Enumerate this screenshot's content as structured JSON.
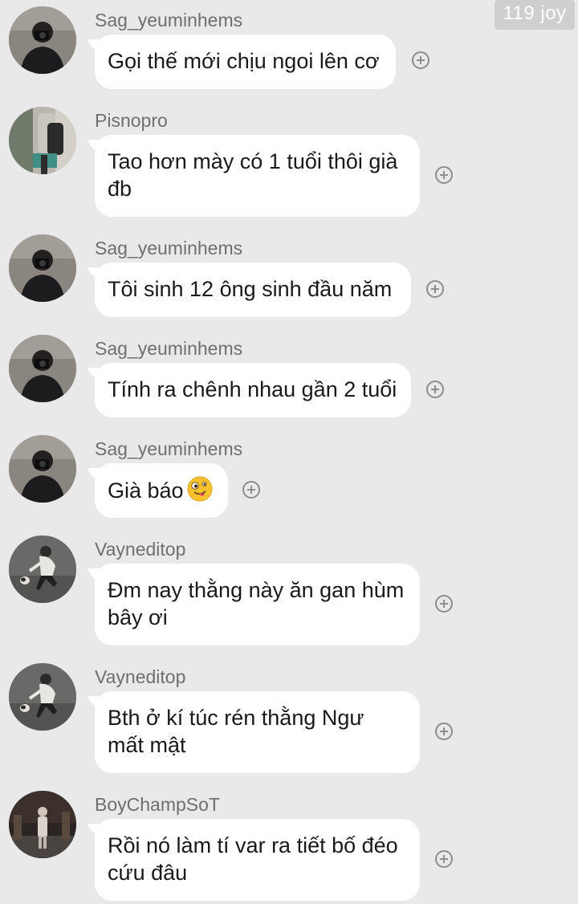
{
  "watermark": "119 joy",
  "messages": [
    {
      "sender": "Sag_yeuminhems",
      "line1": "Gọi thế mới chịu ngoi lên cơ",
      "line2": ""
    },
    {
      "sender": "Pisnopro",
      "line1": "Tao hơn mày có 1 tuổi thôi già",
      "line2": "đb"
    },
    {
      "sender": "Sag_yeuminhems",
      "line1": "Tôi sinh 12 ông sinh đầu năm",
      "line2": ""
    },
    {
      "sender": "Sag_yeuminhems",
      "line1": "Tính ra chênh nhau gần 2 tuổi",
      "line2": ""
    },
    {
      "sender": "Sag_yeuminhems",
      "line1": "Già báo",
      "line2": "",
      "emoji": "zany-face-icon"
    },
    {
      "sender": "Vayneditop",
      "line1": "Đm nay thằng này ăn gan hùm",
      "line2": "bây ơi"
    },
    {
      "sender": "Vayneditop",
      "line1": "Bth ở kí túc rén thằng Ngư",
      "line2": "mất mật"
    },
    {
      "sender": "BoyChampSoT",
      "line1": "Rồi nó làm tí var ra tiết bố đéo",
      "line2": "cứu đâu"
    }
  ]
}
